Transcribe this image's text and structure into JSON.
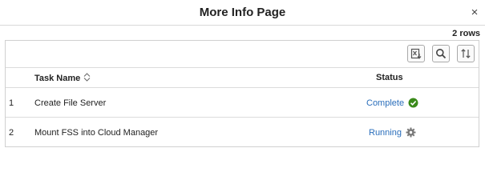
{
  "dialog": {
    "title": "More Info Page",
    "close_symbol": "×",
    "row_count": "2 rows"
  },
  "toolbar": {
    "buttons": [
      {
        "icon": "export-to-excel-icon"
      },
      {
        "icon": "search-icon"
      },
      {
        "icon": "sort-icon"
      }
    ]
  },
  "table": {
    "headers": {
      "task_name": "Task Name",
      "status": "Status"
    },
    "rows": [
      {
        "num": "1",
        "task": "Create File Server",
        "status": "Complete",
        "status_icon": "check-circle-icon",
        "status_color": "#3a8a1a"
      },
      {
        "num": "2",
        "task": "Mount FSS into Cloud Manager",
        "status": "Running",
        "status_icon": "gear-icon",
        "status_color": "#7a7a7a"
      }
    ]
  },
  "colors": {
    "link": "#2a6ebb",
    "border": "#d0d0d0"
  }
}
